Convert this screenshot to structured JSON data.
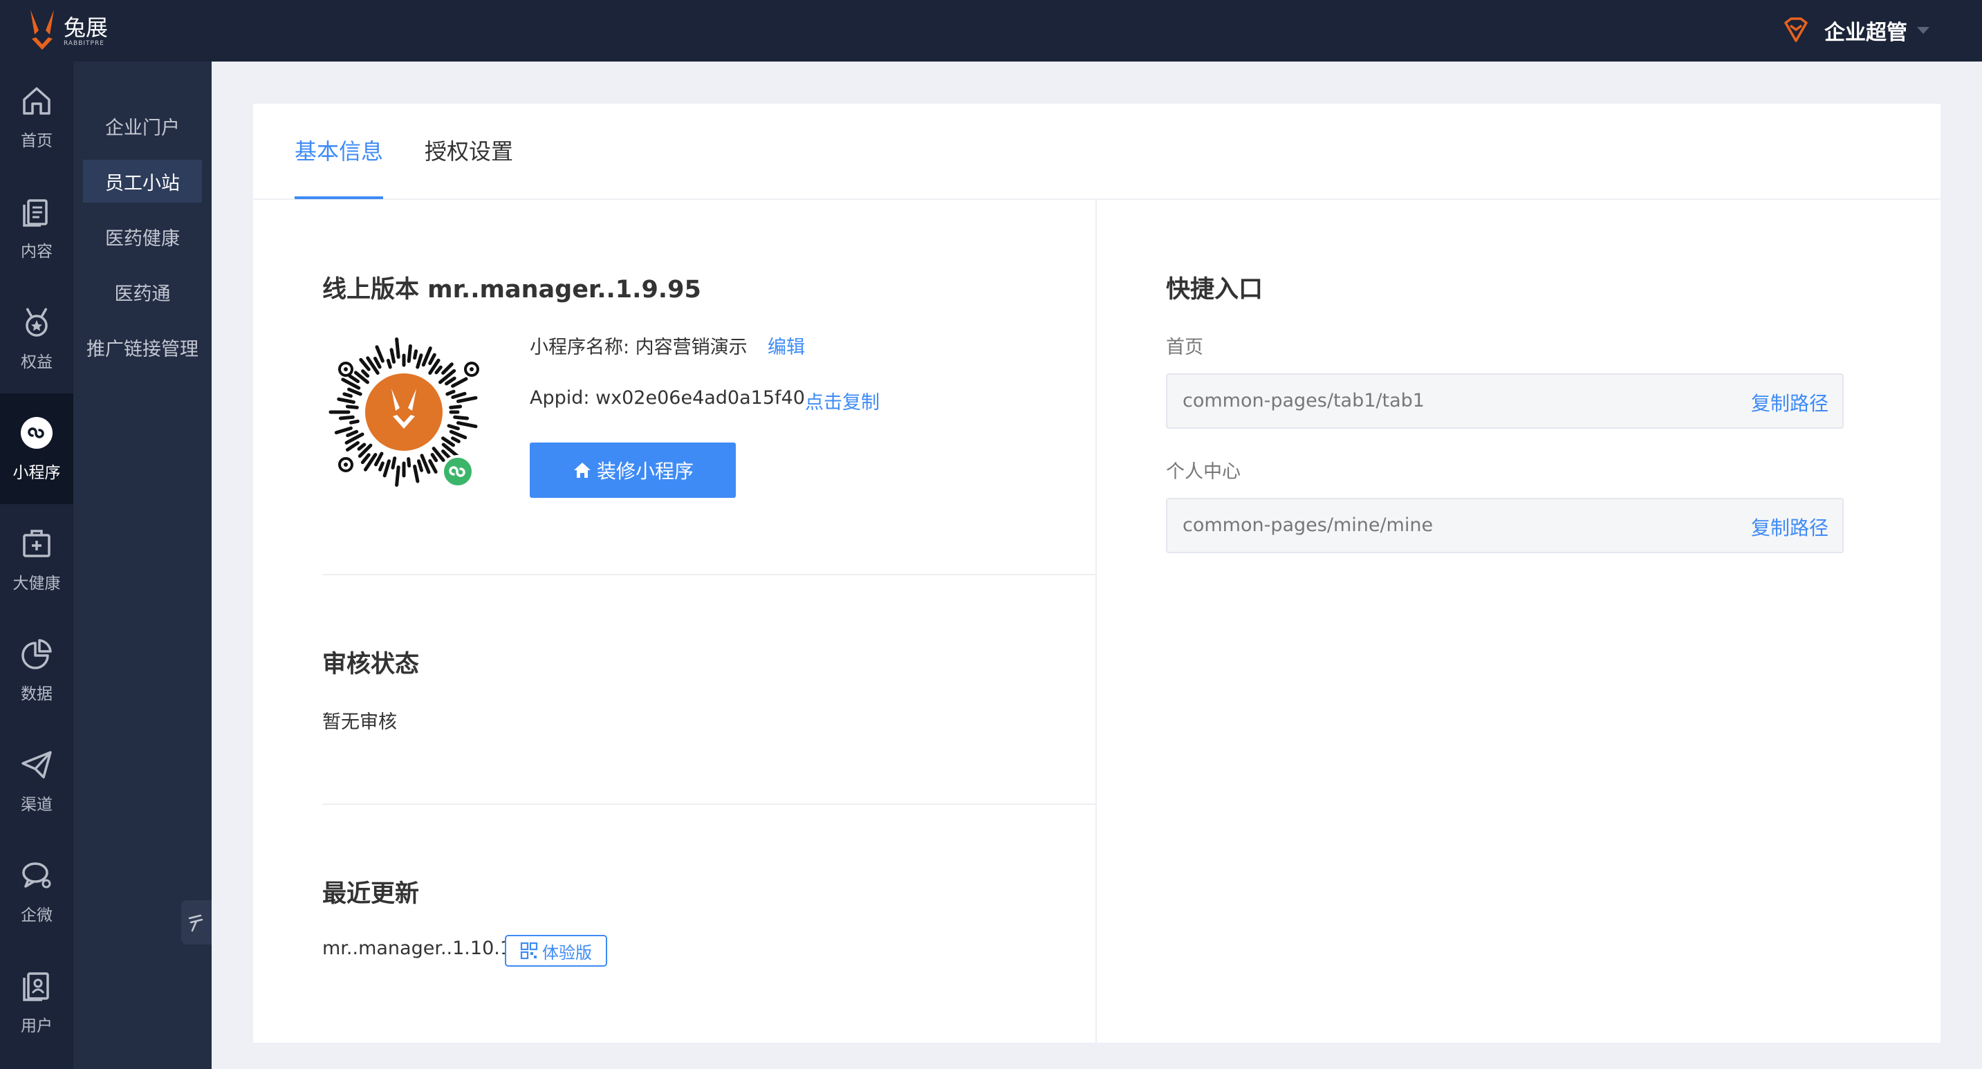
{
  "brand": {
    "name_cn": "兔展",
    "name_en": "RABBITPRE",
    "accent": "#e8621f"
  },
  "header": {
    "user_role": "企业超管",
    "role_icon": "diamond-icon"
  },
  "rail": {
    "items": [
      {
        "label": "首页",
        "icon": "home-icon"
      },
      {
        "label": "内容",
        "icon": "documents-icon"
      },
      {
        "label": "权益",
        "icon": "medal-icon"
      },
      {
        "label": "小程序",
        "icon": "mini-program-icon",
        "active": true
      },
      {
        "label": "大健康",
        "icon": "medical-kit-icon"
      },
      {
        "label": "数据",
        "icon": "pie-chart-icon"
      },
      {
        "label": "渠道",
        "icon": "paper-plane-icon"
      },
      {
        "label": "企微",
        "icon": "chat-bubbles-icon"
      },
      {
        "label": "用户",
        "icon": "user-card-icon"
      }
    ]
  },
  "submenu": {
    "items": [
      {
        "label": "企业门户"
      },
      {
        "label": "员工小站",
        "active": true
      },
      {
        "label": "医药健康"
      },
      {
        "label": "医药通"
      },
      {
        "label": "推广链接管理"
      }
    ]
  },
  "tabs": [
    {
      "label": "基本信息",
      "active": true
    },
    {
      "label": "授权设置"
    }
  ],
  "online_version": {
    "title": "线上版本 mr..manager..1.9.95",
    "name_label": "小程序名称: 内容营销演示",
    "edit_link": "编辑",
    "appid_label": "Appid: wx02e06e4ad0a15f40",
    "copy_link": "点击复制",
    "decorate_button": "装修小程序"
  },
  "review": {
    "title": "审核状态",
    "status": "暂无审核"
  },
  "recent_update": {
    "title": "最近更新",
    "version": "mr..manager..1.10.1",
    "trial_button": "体验版"
  },
  "shortcuts": {
    "title": "快捷入口",
    "items": [
      {
        "label": "首页",
        "path": "common-pages/tab1/tab1",
        "copy": "复制路径"
      },
      {
        "label": "个人中心",
        "path": "common-pages/mine/mine",
        "copy": "复制路径"
      }
    ]
  },
  "colors": {
    "primary": "#3e8bf5",
    "sidebar": "#1b2438",
    "submenu": "#232d44"
  }
}
